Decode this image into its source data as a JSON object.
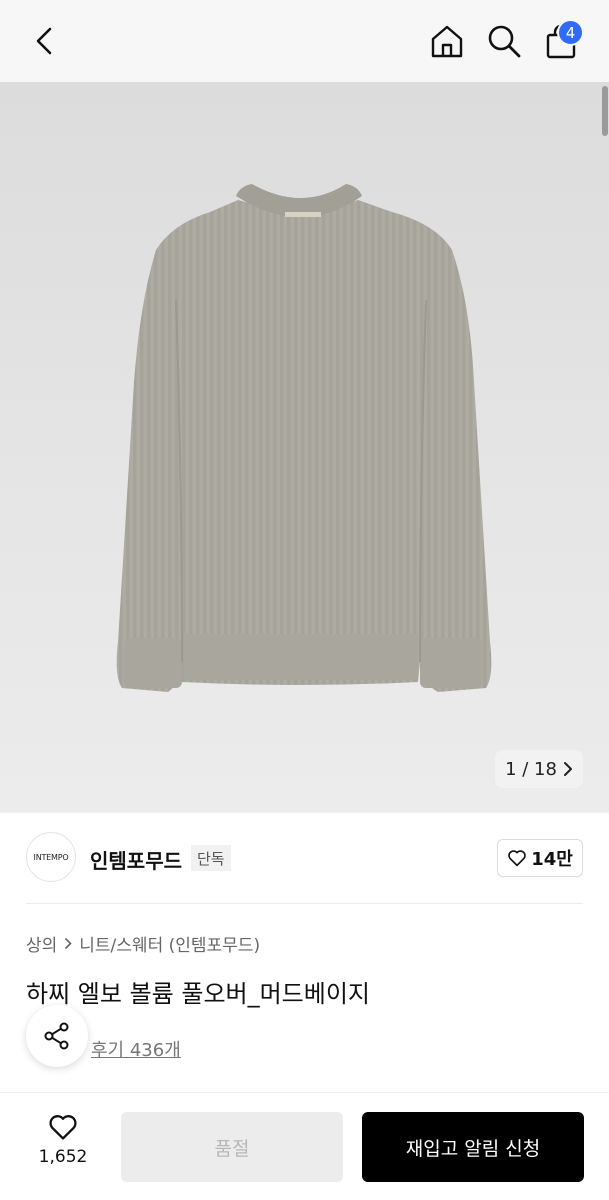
{
  "header": {
    "back_icon": "chevron-left-icon",
    "home_icon": "home-icon",
    "search_icon": "search-icon",
    "cart_icon": "shopping-bag-icon",
    "cart_count": "4",
    "badge_color": "#2f6bf5"
  },
  "gallery": {
    "image_alt": "sweater-image",
    "counter": "1 / 18",
    "next_icon": "chevron-right-icon"
  },
  "brand": {
    "logo_text": "INTEMPO",
    "name": "인템포무드",
    "exclusive_badge": "단독",
    "like_count": "14만"
  },
  "product": {
    "breadcrumb": [
      "상의",
      "니트/스웨터 (인템포무드)"
    ],
    "title": "하찌 엘보 볼륨 풀오버_머드베이지",
    "review_link": "후기 436개"
  },
  "bottom_bar": {
    "wish_count": "1,652",
    "soldout_label": "품절",
    "restock_label": "재입고 알림 신청"
  }
}
